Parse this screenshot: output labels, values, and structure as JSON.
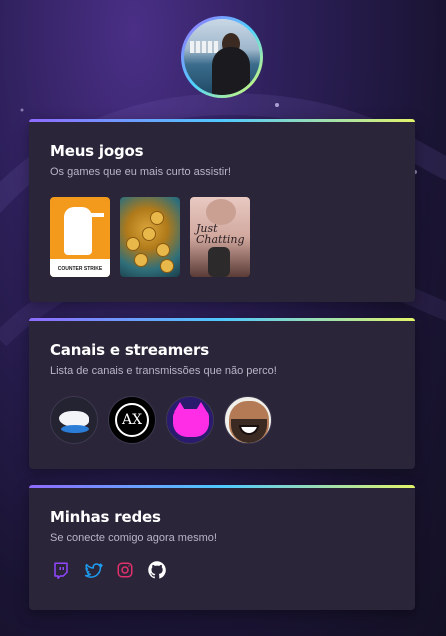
{
  "profile": {
    "avatar_icon": "user-avatar"
  },
  "games_card": {
    "title": "Meus jogos",
    "subtitle": "Os games que eu mais curto assistir!",
    "games": [
      {
        "name": "counter-strike",
        "label": "COUNTER STRIKE"
      },
      {
        "name": "coins-game"
      },
      {
        "name": "just-chatting",
        "label": "Just Chatting"
      }
    ]
  },
  "channels_card": {
    "title": "Canais e streamers",
    "subtitle": "Lista de canais e transmissões que não perco!",
    "channels": [
      {
        "icon": "winged-logo-icon"
      },
      {
        "icon": "ax-logo-icon",
        "label": "AX"
      },
      {
        "icon": "pink-cat-icon"
      },
      {
        "icon": "laughing-streamer-icon"
      }
    ]
  },
  "social_card": {
    "title": "Minhas redes",
    "subtitle": "Se conecte comigo agora mesmo!",
    "links": [
      {
        "icon": "twitch-icon",
        "color": "#9146ff"
      },
      {
        "icon": "twitter-icon",
        "color": "#1d9bf0"
      },
      {
        "icon": "instagram-icon",
        "color": "#e1306c"
      },
      {
        "icon": "github-icon",
        "color": "#ffffff"
      }
    ]
  },
  "colors": {
    "card_bg": "#2a2538",
    "accent_gradient": [
      "#8e6bff",
      "#4fc9ff",
      "#e3f46a"
    ],
    "text_primary": "#ffffff",
    "text_secondary": "#b9b5c7"
  }
}
